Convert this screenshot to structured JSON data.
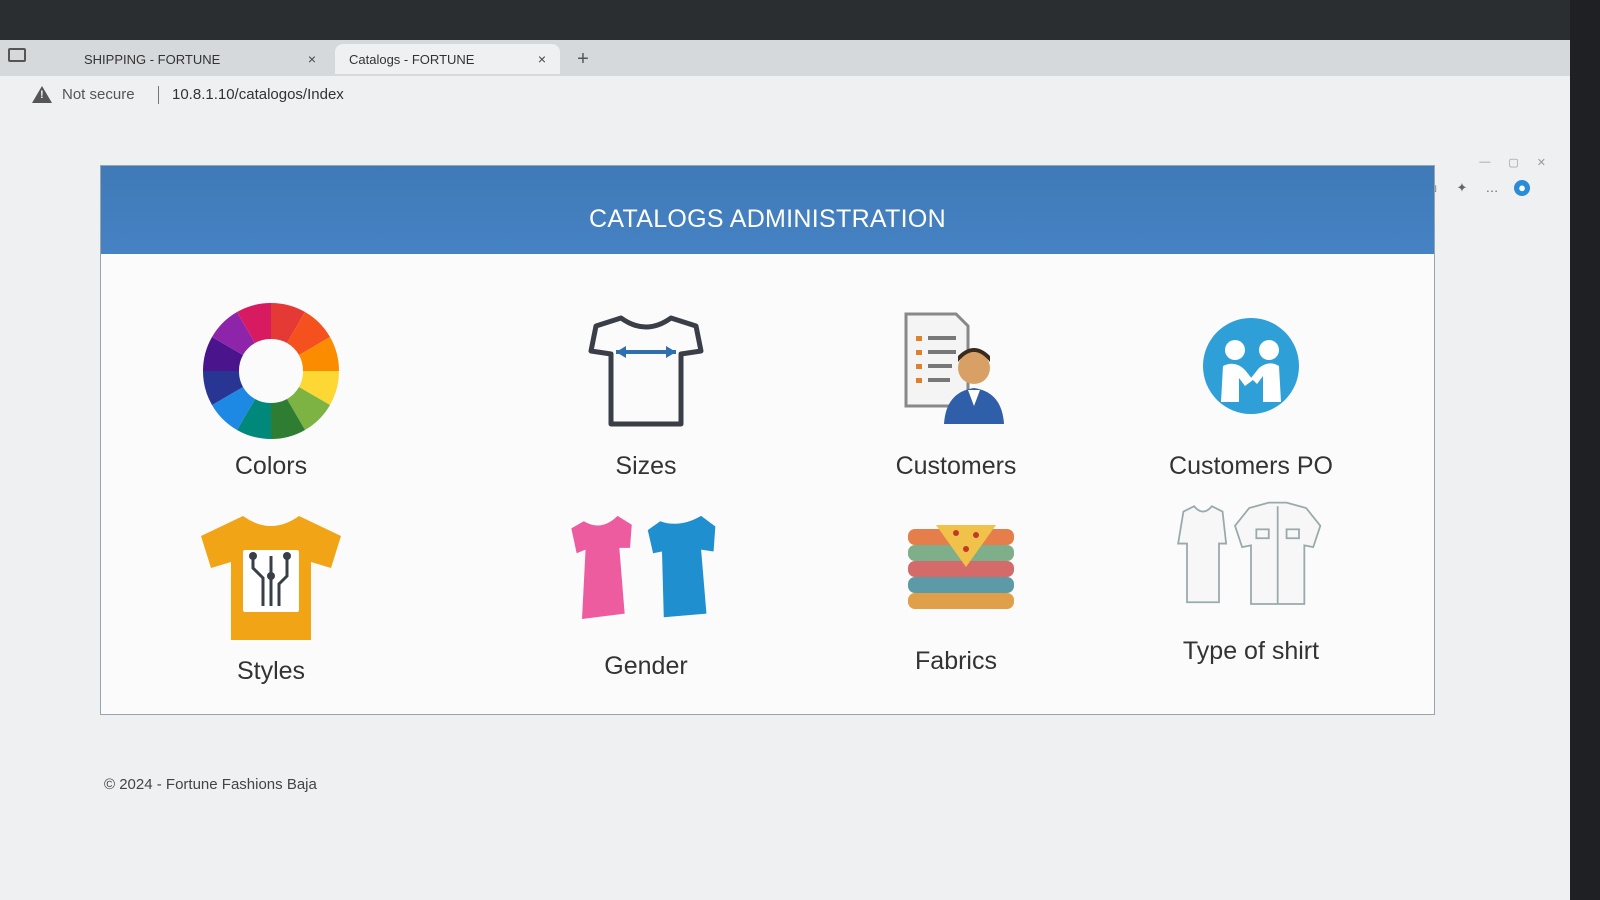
{
  "browser": {
    "tabs": [
      {
        "title": "SHIPPING - FORTUNE",
        "active": false
      },
      {
        "title": "Catalogs - FORTUNE",
        "active": true
      }
    ],
    "new_tab_glyph": "+",
    "close_glyph": "×",
    "security_text": "Not secure",
    "url": "10.8.1.10/catalogos/Index",
    "toolbar_icons": [
      "read-aloud-icon",
      "favorite-star-icon",
      "split-screen-icon",
      "favorites-icon",
      "collections-icon",
      "extensions-icon",
      "more-icon",
      "profile-icon"
    ]
  },
  "page": {
    "header_title": "CATALOGS ADMINISTRATION",
    "header_color": "#4683c4",
    "tiles": [
      {
        "label": "Colors",
        "icon": "color-wheel-icon"
      },
      {
        "label": "Sizes",
        "icon": "tshirt-size-icon"
      },
      {
        "label": "Customers",
        "icon": "customer-document-icon"
      },
      {
        "label": "Customers PO",
        "icon": "handshake-icon"
      },
      {
        "label": "Styles",
        "icon": "styled-tshirt-icon"
      },
      {
        "label": "Gender",
        "icon": "gender-shirts-icon"
      },
      {
        "label": "Fabrics",
        "icon": "fabric-stack-icon"
      },
      {
        "label": "Type of shirt",
        "icon": "shirt-types-icon"
      }
    ],
    "footer": "© 2024 - Fortune Fashions Baja"
  }
}
